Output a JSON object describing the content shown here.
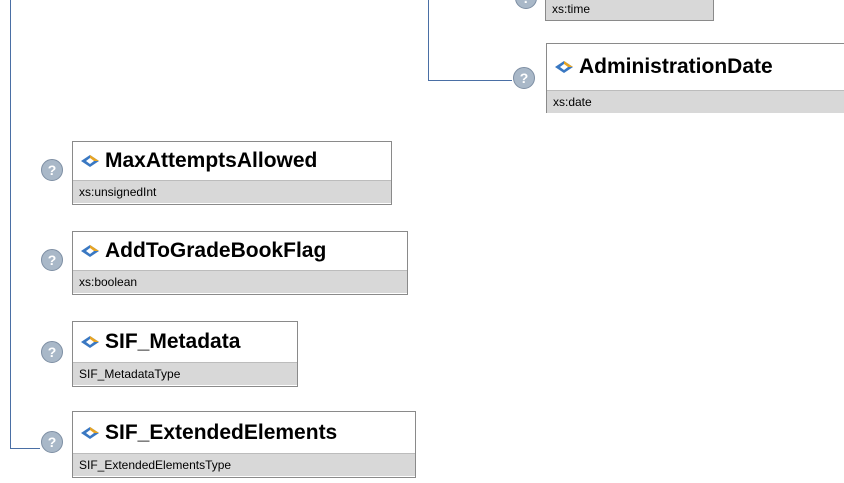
{
  "elements": [
    {
      "name": "",
      "type": "xs:time"
    },
    {
      "name": "AdministrationDate",
      "type": "xs:date"
    },
    {
      "name": "MaxAttemptsAllowed",
      "type": "xs:unsignedInt"
    },
    {
      "name": "AddToGradeBookFlag",
      "type": "xs:boolean"
    },
    {
      "name": "SIF_Metadata",
      "type": "SIF_MetadataType"
    },
    {
      "name": "SIF_ExtendedElements",
      "type": "SIF_ExtendedElementsType"
    }
  ],
  "icons": {
    "element": "element-diamond-icon",
    "help": "question-mark-icon"
  },
  "colors": {
    "connector": "#4a6fa5",
    "type_band": "#d8d8d8",
    "help_icon": "#a9b8c8"
  }
}
